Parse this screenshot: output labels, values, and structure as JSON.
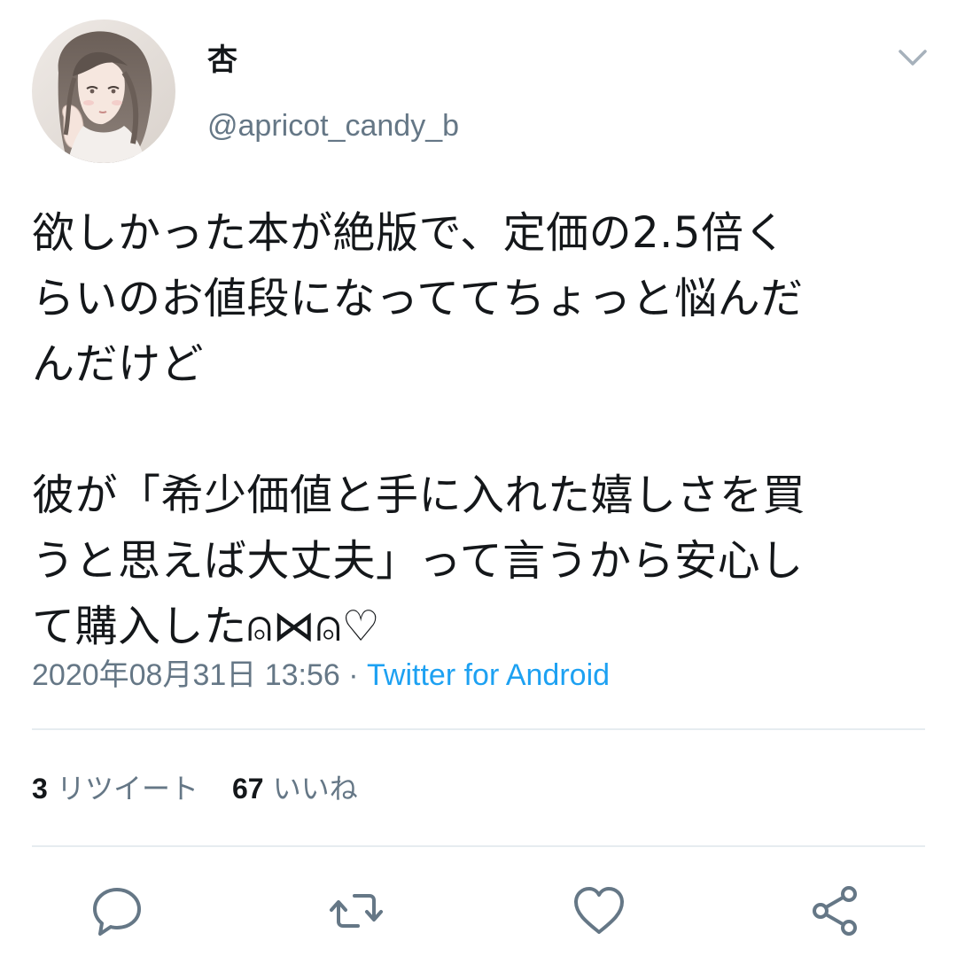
{
  "tweet": {
    "display_name": "杏",
    "handle": "@apricot_candy_b",
    "text": "欲しかった本が絶版で、定価の2.5倍く\nらいのお値段になっててちょっと悩んだ\nんだけど\n\n彼が「希少価値と手に入れた嬉しさを買\nうと思えば大丈夫」って言うから安心し\nて購入した⍝⋈⍝♡",
    "timestamp": "2020年08月31日 13:56",
    "separator": " · ",
    "source": "Twitter for Android"
  },
  "stats": {
    "retweets_count": "3",
    "retweets_label": "リツイート",
    "likes_count": "67",
    "likes_label": "いいね"
  },
  "icons": {
    "caret": "chevron-down-icon",
    "reply": "reply-icon",
    "retweet": "retweet-icon",
    "like": "heart-icon",
    "share": "share-icon"
  },
  "colors": {
    "text_primary": "#14171a",
    "text_secondary": "#657786",
    "link": "#1da1f2",
    "divider": "#e6ecf0",
    "icon": "#657786"
  }
}
